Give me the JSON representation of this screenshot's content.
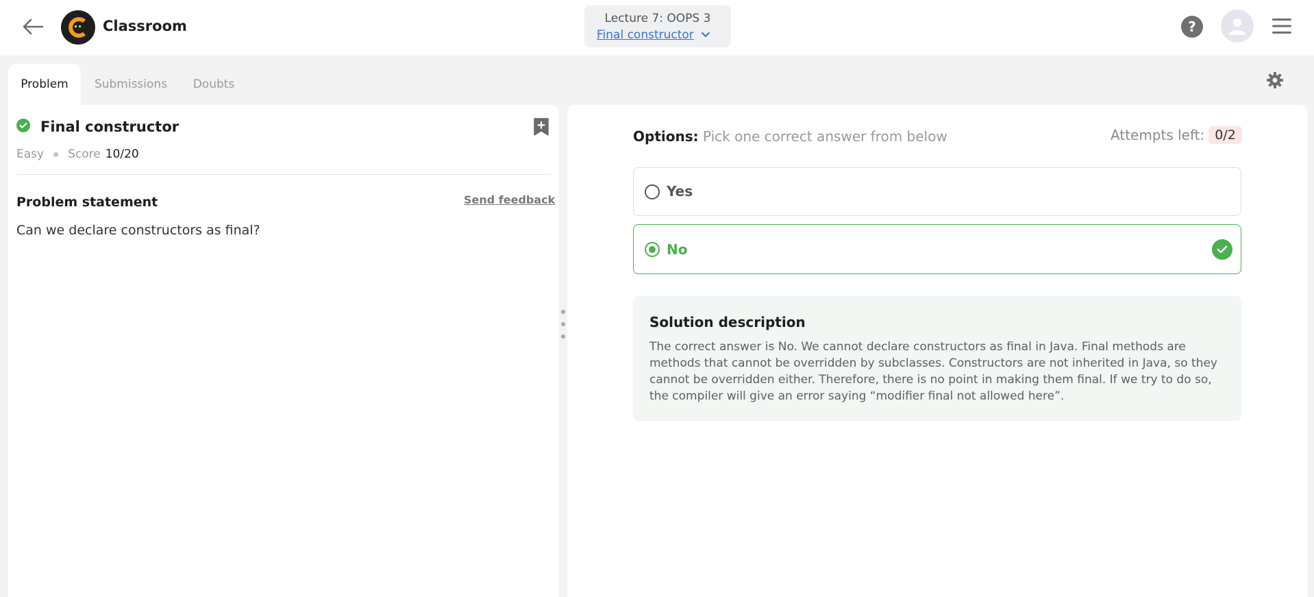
{
  "header": {
    "app_title": "Classroom",
    "lecture": "Lecture 7: OOPS 3",
    "problem_link": "Final constructor",
    "help": "?"
  },
  "tabs": [
    {
      "label": "Problem",
      "active": true
    },
    {
      "label": "Submissions",
      "active": false
    },
    {
      "label": "Doubts",
      "active": false
    }
  ],
  "problem": {
    "title": "Final constructor",
    "status": "solved",
    "difficulty": "Easy",
    "score_label": "Score",
    "score_value": "10/20",
    "statement_heading": "Problem statement",
    "feedback_link": "Send feedback",
    "statement": "Can we declare constructors as final?"
  },
  "options_panel": {
    "label": "Options:",
    "hint": "Pick one correct answer from below",
    "attempts_label": "Attempts left:",
    "attempts_value": "0/2",
    "options": [
      {
        "text": "Yes",
        "selected": false,
        "correct": false
      },
      {
        "text": "No",
        "selected": true,
        "correct": true
      }
    ]
  },
  "solution": {
    "title": "Solution description",
    "text": "The correct answer is No. We cannot declare constructors as final in Java. Final methods are methods that cannot be overridden by subclasses. Constructors are not inherited in Java, so they cannot be overridden either. Therefore, there is no point in making them final. If we try to do so, the compiler will give an error saying “modifier final not allowed here”."
  },
  "colors": {
    "accent_green": "#4caf50",
    "link_blue": "#3b6fd6",
    "attempts_badge_bg": "#fde7e5",
    "logo_orange": "#f39a1e"
  },
  "icons": [
    "back-arrow-icon",
    "logo-icon",
    "chevron-down-icon",
    "help-icon",
    "avatar-icon",
    "menu-icon",
    "settings-gear-icon",
    "check-circle-icon",
    "bookmark-add-icon",
    "resize-handle-icon"
  ]
}
